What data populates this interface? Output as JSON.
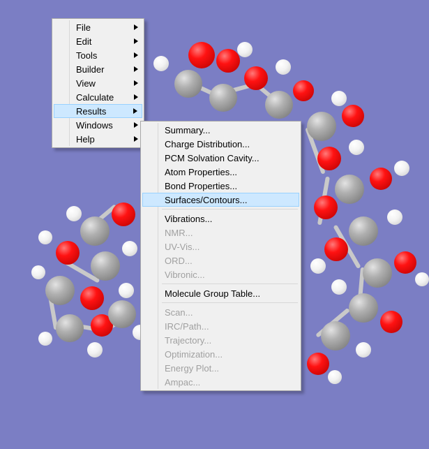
{
  "main_menu": {
    "items": [
      {
        "label": "File",
        "submenu": true
      },
      {
        "label": "Edit",
        "submenu": true
      },
      {
        "label": "Tools",
        "submenu": true
      },
      {
        "label": "Builder",
        "submenu": true
      },
      {
        "label": "View",
        "submenu": true
      },
      {
        "label": "Calculate",
        "submenu": true
      },
      {
        "label": "Results",
        "submenu": true,
        "hovered": true
      },
      {
        "label": "Windows",
        "submenu": true
      },
      {
        "label": "Help",
        "submenu": true
      }
    ]
  },
  "results_submenu": {
    "items": [
      {
        "label": "Summary..."
      },
      {
        "label": "Charge Distribution..."
      },
      {
        "label": "PCM Solvation Cavity..."
      },
      {
        "label": "Atom Properties..."
      },
      {
        "label": "Bond Properties..."
      },
      {
        "label": "Surfaces/Contours...",
        "hovered": true
      },
      {
        "sep": true
      },
      {
        "label": "Vibrations..."
      },
      {
        "label": "NMR...",
        "disabled": true
      },
      {
        "label": "UV-Vis...",
        "disabled": true
      },
      {
        "label": "ORD...",
        "disabled": true
      },
      {
        "label": "Vibronic...",
        "disabled": true
      },
      {
        "sep": true
      },
      {
        "label": "Molecule Group Table..."
      },
      {
        "sep": true
      },
      {
        "label": "Scan...",
        "disabled": true
      },
      {
        "label": "IRC/Path...",
        "disabled": true
      },
      {
        "label": "Trajectory...",
        "disabled": true
      },
      {
        "label": "Optimization...",
        "disabled": true
      },
      {
        "label": "Energy Plot...",
        "disabled": true
      },
      {
        "label": "Ampac...",
        "disabled": true
      }
    ]
  },
  "colors": {
    "viewport_bg": "#7b7ec4",
    "menu_bg": "#f0f0f0",
    "menu_border": "#a8a8a8",
    "hover_bg": "#cde8ff",
    "hover_border": "#99d1ff",
    "disabled": "#a0a0a0"
  }
}
